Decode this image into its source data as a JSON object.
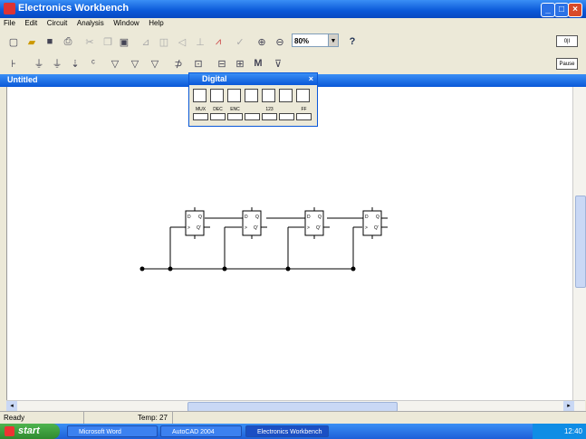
{
  "window": {
    "title": "Electronics Workbench"
  },
  "menu": [
    "File",
    "Edit",
    "Circuit",
    "Analysis",
    "Window",
    "Help"
  ],
  "toolbar": {
    "zoom_value": "80%",
    "help_label": "?"
  },
  "document": {
    "title": "Untitled"
  },
  "digital_palette": {
    "title": "Digital",
    "labels": [
      "MUX",
      "DEC",
      "ENC",
      "",
      "123",
      "",
      "FF"
    ]
  },
  "right_buttons": {
    "pause_label": "Pause"
  },
  "status": {
    "left": "Ready",
    "temp": "Temp: 27"
  },
  "taskbar": {
    "start_label": "start",
    "tasks": [
      "Microsoft Word",
      "AutoCAD 2004",
      "Electronics Workbench"
    ],
    "clock": "12:40"
  },
  "flipflop_labels": {
    "d": "D",
    "q": "Q",
    "clk": ">",
    "qn": "Q'"
  }
}
